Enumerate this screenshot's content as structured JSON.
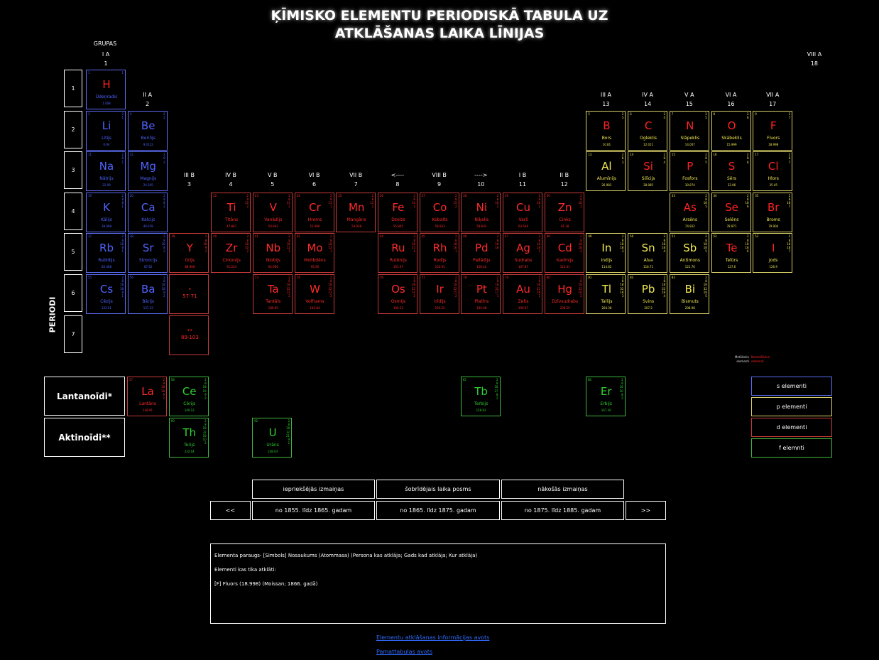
{
  "title": {
    "line1": "ĶĪMISKO ELEMENTU PERIODISKĀ TABULA UZ",
    "line2": "ATKLĀŠANAS LAIKA LĪNIJAS"
  },
  "groups_label": "GRUPAS",
  "group_headers": [
    {
      "roman": "I A",
      "num": "1"
    },
    {
      "roman": "II A",
      "num": "2"
    },
    {
      "roman": "III B",
      "num": "3"
    },
    {
      "roman": "IV B",
      "num": "4"
    },
    {
      "roman": "V B",
      "num": "5"
    },
    {
      "roman": "VI B",
      "num": "6"
    },
    {
      "roman": "VII B",
      "num": "7"
    },
    {
      "roman": "<----",
      "num": "8"
    },
    {
      "roman": "VIII B",
      "num": "9"
    },
    {
      "roman": "---->",
      "num": "10"
    },
    {
      "roman": "I B",
      "num": "11"
    },
    {
      "roman": "II B",
      "num": "12"
    },
    {
      "roman": "III A",
      "num": "13"
    },
    {
      "roman": "IV A",
      "num": "14"
    },
    {
      "roman": "V A",
      "num": "15"
    },
    {
      "roman": "VI A",
      "num": "16"
    },
    {
      "roman": "VII A",
      "num": "17"
    },
    {
      "roman": "VIII A",
      "num": "18"
    }
  ],
  "periods": [
    "1",
    "2",
    "3",
    "4",
    "5",
    "6",
    "7"
  ],
  "period_label": "PERIODI",
  "elements": [
    {
      "n": "1",
      "sym": "H",
      "name": "Ūdeņradis",
      "mass": "1.008",
      "shells": "1",
      "t": "s",
      "g": 1,
      "p": 1,
      "nonmetal": true
    },
    {
      "n": "3",
      "sym": "Li",
      "name": "Litijs",
      "mass": "6.94",
      "shells": "2\n1",
      "t": "s",
      "g": 1,
      "p": 2
    },
    {
      "n": "4",
      "sym": "Be",
      "name": "Berilijs",
      "mass": "9.0122",
      "shells": "2\n2",
      "t": "s",
      "g": 2,
      "p": 2
    },
    {
      "n": "5",
      "sym": "B",
      "name": "Bors",
      "mass": "10.81",
      "shells": "2\n3",
      "t": "p",
      "g": 13,
      "p": 2,
      "nonmetal": true
    },
    {
      "n": "6",
      "sym": "C",
      "name": "Ogleklis",
      "mass": "12.011",
      "shells": "2\n4",
      "t": "p",
      "g": 14,
      "p": 2,
      "nonmetal": true
    },
    {
      "n": "7",
      "sym": "N",
      "name": "Slāpeklis",
      "mass": "14.007",
      "shells": "2\n5",
      "t": "p",
      "g": 15,
      "p": 2,
      "nonmetal": true
    },
    {
      "n": "8",
      "sym": "O",
      "name": "Skābeklis",
      "mass": "15.999",
      "shells": "2\n6",
      "t": "p",
      "g": 16,
      "p": 2,
      "nonmetal": true
    },
    {
      "n": "9",
      "sym": "F",
      "name": "Fluors",
      "mass": "18.998",
      "shells": "2\n7",
      "t": "p",
      "g": 17,
      "p": 2,
      "nonmetal": true
    },
    {
      "n": "11",
      "sym": "Na",
      "name": "Nātrijs",
      "mass": "22.99",
      "shells": "2\n8\n1",
      "t": "s",
      "g": 1,
      "p": 3
    },
    {
      "n": "12",
      "sym": "Mg",
      "name": "Magnijs",
      "mass": "24.305",
      "shells": "2\n8\n2",
      "t": "s",
      "g": 2,
      "p": 3
    },
    {
      "n": "13",
      "sym": "Al",
      "name": "Alumīnijs",
      "mass": "26.982",
      "shells": "2\n8\n3",
      "t": "p",
      "g": 13,
      "p": 3
    },
    {
      "n": "14",
      "sym": "Si",
      "name": "Silīcijs",
      "mass": "28.085",
      "shells": "2\n8\n4",
      "t": "p",
      "g": 14,
      "p": 3,
      "nonmetal": true
    },
    {
      "n": "15",
      "sym": "P",
      "name": "Fosfors",
      "mass": "30.974",
      "shells": "2\n8\n5",
      "t": "p",
      "g": 15,
      "p": 3,
      "nonmetal": true
    },
    {
      "n": "16",
      "sym": "S",
      "name": "Sērs",
      "mass": "32.06",
      "shells": "2\n8\n6",
      "t": "p",
      "g": 16,
      "p": 3,
      "nonmetal": true
    },
    {
      "n": "17",
      "sym": "Cl",
      "name": "Hlors",
      "mass": "35.45",
      "shells": "2\n8\n7",
      "t": "p",
      "g": 17,
      "p": 3,
      "nonmetal": true
    },
    {
      "n": "19",
      "sym": "K",
      "name": "Kālijs",
      "mass": "39.098",
      "shells": "2\n8\n8\n1",
      "t": "s",
      "g": 1,
      "p": 4
    },
    {
      "n": "20",
      "sym": "Ca",
      "name": "Kalcijs",
      "mass": "40.078",
      "shells": "2\n8\n8\n2",
      "t": "s",
      "g": 2,
      "p": 4
    },
    {
      "n": "22",
      "sym": "Ti",
      "name": "Titāns",
      "mass": "47.867",
      "shells": "2\n8\n10\n2",
      "t": "d",
      "g": 4,
      "p": 4
    },
    {
      "n": "23",
      "sym": "V",
      "name": "Vanādijs",
      "mass": "50.942",
      "shells": "2\n8\n11\n2",
      "t": "d",
      "g": 5,
      "p": 4
    },
    {
      "n": "24",
      "sym": "Cr",
      "name": "Hroms",
      "mass": "51.996",
      "shells": "2\n8\n13\n1",
      "t": "d",
      "g": 6,
      "p": 4
    },
    {
      "n": "25",
      "sym": "Mn",
      "name": "Mangāns",
      "mass": "54.938",
      "shells": "2\n8\n13\n2",
      "t": "d",
      "g": 7,
      "p": 4
    },
    {
      "n": "26",
      "sym": "Fe",
      "name": "Dzelzs",
      "mass": "55.845",
      "shells": "2\n8\n14\n2",
      "t": "d",
      "g": 8,
      "p": 4
    },
    {
      "n": "27",
      "sym": "Co",
      "name": "Kobalts",
      "mass": "58.933",
      "shells": "2\n8\n15\n2",
      "t": "d",
      "g": 9,
      "p": 4
    },
    {
      "n": "28",
      "sym": "Ni",
      "name": "Niķelis",
      "mass": "58.693",
      "shells": "2\n8\n16\n2",
      "t": "d",
      "g": 10,
      "p": 4
    },
    {
      "n": "29",
      "sym": "Cu",
      "name": "Varš",
      "mass": "63.546",
      "shells": "2\n8\n18\n1",
      "t": "d",
      "g": 11,
      "p": 4
    },
    {
      "n": "30",
      "sym": "Zn",
      "name": "Cinks",
      "mass": "65.38",
      "shells": "2\n8\n18\n2",
      "t": "d",
      "g": 12,
      "p": 4
    },
    {
      "n": "33",
      "sym": "As",
      "name": "Arsēns",
      "mass": "74.922",
      "shells": "2\n8\n18\n5",
      "t": "p",
      "g": 15,
      "p": 4,
      "nonmetal": true
    },
    {
      "n": "34",
      "sym": "Se",
      "name": "Selēns",
      "mass": "78.971",
      "shells": "2\n8\n18\n6",
      "t": "p",
      "g": 16,
      "p": 4,
      "nonmetal": true
    },
    {
      "n": "35",
      "sym": "Br",
      "name": "Broms",
      "mass": "79.904",
      "shells": "2\n8\n18\n7",
      "t": "p",
      "g": 17,
      "p": 4,
      "nonmetal": true
    },
    {
      "n": "37",
      "sym": "Rb",
      "name": "Rubīdijs",
      "mass": "85.468",
      "shells": "2\n8\n18\n8\n1",
      "t": "s",
      "g": 1,
      "p": 5
    },
    {
      "n": "38",
      "sym": "Sr",
      "name": "Stroncijs",
      "mass": "87.62",
      "shells": "2\n8\n18\n8\n2",
      "t": "s",
      "g": 2,
      "p": 5
    },
    {
      "n": "39",
      "sym": "Y",
      "name": "Itrijs",
      "mass": "88.906",
      "shells": "2\n8\n18\n9\n2",
      "t": "d",
      "g": 3,
      "p": 5
    },
    {
      "n": "40",
      "sym": "Zr",
      "name": "Cirkonijs",
      "mass": "91.224",
      "shells": "2\n8\n18\n10\n2",
      "t": "d",
      "g": 4,
      "p": 5
    },
    {
      "n": "41",
      "sym": "Nb",
      "name": "Niobijs",
      "mass": "92.906",
      "shells": "2\n8\n18\n12\n1",
      "t": "d",
      "g": 5,
      "p": 5
    },
    {
      "n": "42",
      "sym": "Mo",
      "name": "Molibdēns",
      "mass": "95.95",
      "shells": "2\n8\n18\n13\n1",
      "t": "d",
      "g": 6,
      "p": 5
    },
    {
      "n": "44",
      "sym": "Ru",
      "name": "Rutēnijs",
      "mass": "101.07",
      "shells": "2\n8\n18\n15\n1",
      "t": "d",
      "g": 8,
      "p": 5
    },
    {
      "n": "45",
      "sym": "Rh",
      "name": "Rodijs",
      "mass": "102.91",
      "shells": "2\n8\n18\n16\n1",
      "t": "d",
      "g": 9,
      "p": 5
    },
    {
      "n": "46",
      "sym": "Pd",
      "name": "Pallādijs",
      "mass": "106.42",
      "shells": "2\n8\n18\n18",
      "t": "d",
      "g": 10,
      "p": 5
    },
    {
      "n": "47",
      "sym": "Ag",
      "name": "Sudrabs",
      "mass": "107.87",
      "shells": "2\n8\n18\n18\n1",
      "t": "d",
      "g": 11,
      "p": 5
    },
    {
      "n": "48",
      "sym": "Cd",
      "name": "Kadmijs",
      "mass": "112.41",
      "shells": "2\n8\n18\n18\n2",
      "t": "d",
      "g": 12,
      "p": 5
    },
    {
      "n": "49",
      "sym": "In",
      "name": "Indijs",
      "mass": "114.82",
      "shells": "2\n8\n18\n18\n3",
      "t": "p",
      "g": 13,
      "p": 5
    },
    {
      "n": "50",
      "sym": "Sn",
      "name": "Alva",
      "mass": "118.71",
      "shells": "2\n8\n18\n18\n4",
      "t": "p",
      "g": 14,
      "p": 5
    },
    {
      "n": "51",
      "sym": "Sb",
      "name": "Antimons",
      "mass": "121.76",
      "shells": "2\n8\n18\n18\n5",
      "t": "p",
      "g": 15,
      "p": 5
    },
    {
      "n": "52",
      "sym": "Te",
      "name": "Telūrs",
      "mass": "127.6",
      "shells": "2\n8\n18\n18\n6",
      "t": "p",
      "g": 16,
      "p": 5,
      "nonmetal": true
    },
    {
      "n": "53",
      "sym": "I",
      "name": "Jods",
      "mass": "126.9",
      "shells": "2\n8\n18\n18\n7",
      "t": "p",
      "g": 17,
      "p": 5,
      "nonmetal": true
    },
    {
      "n": "55",
      "sym": "Cs",
      "name": "Cēzijs",
      "mass": "132.91",
      "shells": "2\n8\n18\n18\n8\n1",
      "t": "s",
      "g": 1,
      "p": 6
    },
    {
      "n": "56",
      "sym": "Ba",
      "name": "Bārijs",
      "mass": "137.33",
      "shells": "2\n8\n18\n18\n8\n2",
      "t": "s",
      "g": 2,
      "p": 6
    },
    {
      "n": "73",
      "sym": "Ta",
      "name": "Tantāls",
      "mass": "180.95",
      "shells": "2\n8\n18\n32\n11\n2",
      "t": "d",
      "g": 5,
      "p": 6
    },
    {
      "n": "74",
      "sym": "W",
      "name": "Volframs",
      "mass": "183.84",
      "shells": "2\n8\n18\n32\n12\n2",
      "t": "d",
      "g": 6,
      "p": 6
    },
    {
      "n": "76",
      "sym": "Os",
      "name": "Osmijs",
      "mass": "190.23",
      "shells": "2\n8\n18\n32\n14\n2",
      "t": "d",
      "g": 8,
      "p": 6
    },
    {
      "n": "77",
      "sym": "Ir",
      "name": "Irīdijs",
      "mass": "192.22",
      "shells": "2\n8\n18\n32\n15\n2",
      "t": "d",
      "g": 9,
      "p": 6
    },
    {
      "n": "78",
      "sym": "Pt",
      "name": "Platīns",
      "mass": "195.08",
      "shells": "2\n8\n18\n32\n17\n1",
      "t": "d",
      "g": 10,
      "p": 6
    },
    {
      "n": "79",
      "sym": "Au",
      "name": "Zelts",
      "mass": "196.97",
      "shells": "2\n8\n18\n32\n18\n1",
      "t": "d",
      "g": 11,
      "p": 6
    },
    {
      "n": "80",
      "sym": "Hg",
      "name": "Dzīvsudrabs",
      "mass": "200.59",
      "shells": "2\n8\n18\n32\n18\n2",
      "t": "d",
      "g": 12,
      "p": 6
    },
    {
      "n": "81",
      "sym": "Tl",
      "name": "Tallijs",
      "mass": "204.38",
      "shells": "2\n8\n18\n32\n18\n3",
      "t": "p",
      "g": 13,
      "p": 6
    },
    {
      "n": "82",
      "sym": "Pb",
      "name": "Svins",
      "mass": "207.2",
      "shells": "2\n8\n18\n32\n18\n4",
      "t": "p",
      "g": 14,
      "p": 6
    },
    {
      "n": "83",
      "sym": "Bi",
      "name": "Bismuts",
      "mass": "208.98",
      "shells": "2\n8\n18\n32\n18\n5",
      "t": "p",
      "g": 15,
      "p": 6
    }
  ],
  "placeholders": [
    {
      "mark": "*",
      "range": "57-71",
      "g": 3,
      "p": 6
    },
    {
      "mark": "**",
      "range": "89-103",
      "g": 3,
      "p": 7
    }
  ],
  "series": [
    {
      "label": "Lantanoīdi*",
      "row": 0,
      "elements": [
        {
          "n": "57",
          "sym": "La",
          "name": "Lantāns",
          "mass": "138.91",
          "shells": "2\n8\n18\n18\n9\n2",
          "t": "d",
          "col": 0
        },
        {
          "n": "58",
          "sym": "Ce",
          "name": "Cērijs",
          "mass": "140.12",
          "shells": "2\n8\n18\n19\n9\n2",
          "t": "f",
          "col": 1
        },
        {
          "n": "65",
          "sym": "Tb",
          "name": "Terbijs",
          "mass": "158.93",
          "shells": "2\n8\n18\n27\n8\n2",
          "t": "f",
          "col": 8
        },
        {
          "n": "68",
          "sym": "Er",
          "name": "Erbijs",
          "mass": "167.26",
          "shells": "2\n8\n18\n30\n8\n2",
          "t": "f",
          "col": 11
        }
      ]
    },
    {
      "label": "Aktinoīdi**",
      "row": 1,
      "elements": [
        {
          "n": "90",
          "sym": "Th",
          "name": "Torijs",
          "mass": "232.04",
          "shells": "2\n8\n18\n32\n18\n10\n2",
          "t": "f",
          "col": 1
        },
        {
          "n": "92",
          "sym": "U",
          "name": "Urāns",
          "mass": "238.03",
          "shells": "2\n8\n18\n32\n21\n9\n2",
          "t": "f",
          "col": 3
        }
      ]
    }
  ],
  "mini_legend": {
    "metals_line1": "Metāliskie",
    "metals_line2": "elementi",
    "nonmetals_line1": "Nemetāliskie",
    "nonmetals_line2": "elementi"
  },
  "legend": [
    {
      "label": "s elementi",
      "color": "#5b6cf2"
    },
    {
      "label": "p elementi",
      "color": "#d9cf67"
    },
    {
      "label": "d elementi",
      "color": "#c63a3a"
    },
    {
      "label": "f elemnti",
      "color": "#3fb63f"
    }
  ],
  "colors": {
    "s": "#4f63ff",
    "p": "#f2ea53",
    "d": "#ff2a2a",
    "f": "#2fd32f",
    "nonmetal_text": "#ff2222",
    "link": "#2f6bff"
  },
  "nav": {
    "prev_header": "iepriekšējās izmaiņas",
    "current_header": "šobrīdējais laika posms",
    "next_header": "nākošās izmaiņas",
    "back_button": "<<",
    "forward_button": ">>",
    "prev_period": "no 1855. līdz 1865. gadam",
    "current_period": "no 1865. līdz 1875. gadam",
    "next_period": "no 1875. līdz 1885. gadam"
  },
  "info": {
    "example": "Elementa paraugs- [Simbols] Nosaukums (Atommasa) (Persona kas atklāja; Gads kad atklāja; Kur atklāja)",
    "discovered_label": "Elementi kas tika atklāti:",
    "discovered": [
      "[F] Fluors (18.998) (Moissan; 1866. gadā)"
    ]
  },
  "links": {
    "discovery_source": "Elementu atklāšanas informācijas avots",
    "base_table_source": "Pamattabulas avots"
  }
}
